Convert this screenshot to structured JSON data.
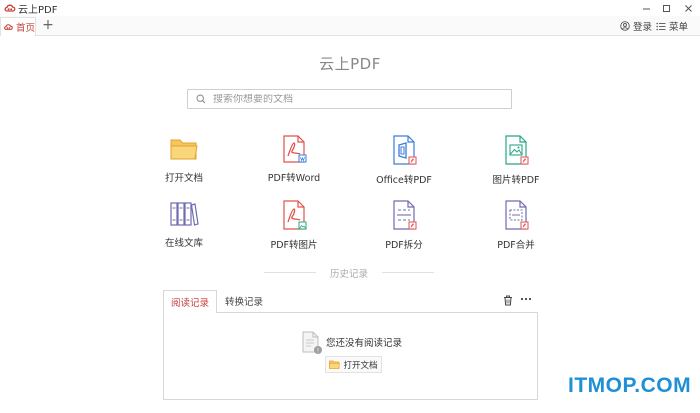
{
  "window": {
    "title": "云上PDF"
  },
  "tabs": {
    "home_label": "首页",
    "add_label": "+"
  },
  "header": {
    "login_label": "登录",
    "menu_label": "菜单"
  },
  "main": {
    "app_title": "云上PDF",
    "search_placeholder": "搜索你想要的文档"
  },
  "tools": [
    {
      "label": "打开文档",
      "icon": "folder-icon"
    },
    {
      "label": "PDF转Word",
      "icon": "pdf-to-word-icon"
    },
    {
      "label": "Office转PDF",
      "icon": "office-to-pdf-icon"
    },
    {
      "label": "图片转PDF",
      "icon": "image-to-pdf-icon"
    },
    {
      "label": "在线文库",
      "icon": "library-icon"
    },
    {
      "label": "PDF转图片",
      "icon": "pdf-to-image-icon"
    },
    {
      "label": "PDF拆分",
      "icon": "pdf-split-icon"
    },
    {
      "label": "PDF合并",
      "icon": "pdf-merge-icon"
    }
  ],
  "history": {
    "heading": "历史记录",
    "tab_reading": "阅读记录",
    "tab_convert": "转换记录",
    "empty_text": "您还没有阅读记录",
    "open_button": "打开文档"
  },
  "watermark": "ITMOP.COM",
  "colors": {
    "accent": "#c7423c",
    "pdf_red": "#e0524c",
    "office_blue": "#3b7dd8",
    "image_green": "#2aa58a",
    "folder_yellow": "#f2b233",
    "library_purple": "#6f6bb0",
    "watermark_blue": "#1f8fd6"
  }
}
